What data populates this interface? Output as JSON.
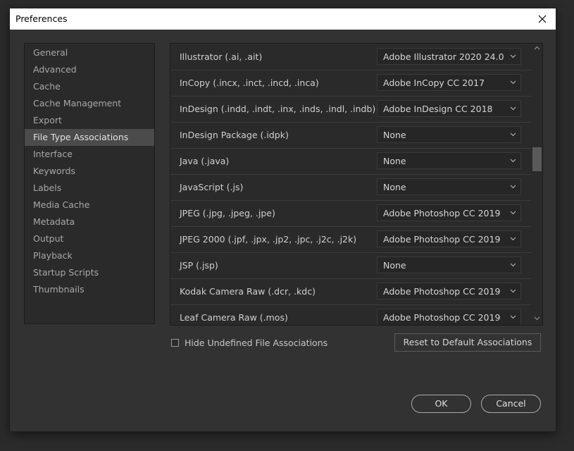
{
  "window": {
    "title": "Preferences",
    "close_icon": "close-icon"
  },
  "sidebar": {
    "items": [
      {
        "label": "General",
        "selected": false
      },
      {
        "label": "Advanced",
        "selected": false
      },
      {
        "label": "Cache",
        "selected": false
      },
      {
        "label": "Cache Management",
        "selected": false
      },
      {
        "label": "Export",
        "selected": false
      },
      {
        "label": "File Type Associations",
        "selected": true
      },
      {
        "label": "Interface",
        "selected": false
      },
      {
        "label": "Keywords",
        "selected": false
      },
      {
        "label": "Labels",
        "selected": false
      },
      {
        "label": "Media Cache",
        "selected": false
      },
      {
        "label": "Metadata",
        "selected": false
      },
      {
        "label": "Output",
        "selected": false
      },
      {
        "label": "Playback",
        "selected": false
      },
      {
        "label": "Startup Scripts",
        "selected": false
      },
      {
        "label": "Thumbnails",
        "selected": false
      }
    ]
  },
  "associations": [
    {
      "file_type": "Illustrator (.ai, .ait)",
      "application": "Adobe Illustrator 2020 24.0"
    },
    {
      "file_type": "InCopy (.incx, .inct, .incd, .inca)",
      "application": "Adobe InCopy CC 2017"
    },
    {
      "file_type": "InDesign (.indd, .indt, .inx, .inds, .indl, .indb)",
      "application": "Adobe InDesign CC 2018"
    },
    {
      "file_type": "InDesign Package (.idpk)",
      "application": "None"
    },
    {
      "file_type": "Java (.java)",
      "application": "None"
    },
    {
      "file_type": "JavaScript (.js)",
      "application": "None"
    },
    {
      "file_type": "JPEG (.jpg, .jpeg, .jpe)",
      "application": "Adobe Photoshop CC 2019"
    },
    {
      "file_type": "JPEG 2000 (.jpf, .jpx, .jp2, .jpc, .j2c, .j2k)",
      "application": "Adobe Photoshop CC 2019"
    },
    {
      "file_type": "JSP (.jsp)",
      "application": "None"
    },
    {
      "file_type": "Kodak Camera Raw (.dcr, .kdc)",
      "application": "Adobe Photoshop CC 2019"
    },
    {
      "file_type": "Leaf Camera Raw (.mos)",
      "application": "Adobe Photoshop CC 2019"
    }
  ],
  "options": {
    "hide_undefined_label": "Hide Undefined File Associations",
    "hide_undefined_checked": false,
    "reset_label": "Reset to Default Associations"
  },
  "footer": {
    "ok_label": "OK",
    "cancel_label": "Cancel"
  },
  "colors": {
    "background": "#323232",
    "selected_item": "#4b4b4b",
    "titlebar": "#ffffff"
  }
}
